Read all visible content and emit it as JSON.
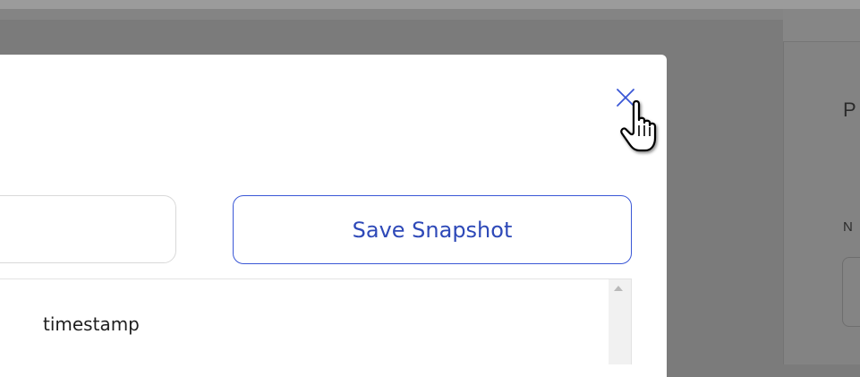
{
  "modal": {
    "save_button_label": "Save Snapshot",
    "table_header": "timestamp",
    "name_input_value": ""
  },
  "background": {
    "side_title_fragment": "P",
    "side_label_fragment": "N"
  },
  "colors": {
    "accent": "#3a57d6",
    "overlay": "#7b7b7b"
  },
  "icons": {
    "close": "close-icon",
    "cursor": "hand-pointer-cursor-icon",
    "scroll_up": "scroll-up-arrow-icon"
  }
}
